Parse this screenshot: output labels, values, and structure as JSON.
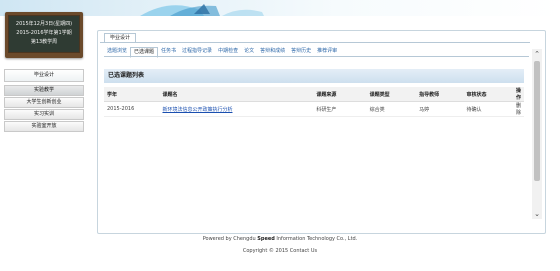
{
  "board": {
    "line1": "2015年12月3日(星期四)",
    "line2": "2015-2016学年第1学期",
    "line3": "第13教学周"
  },
  "sidebar": {
    "items": [
      {
        "label": "毕业设计"
      },
      {
        "label": "实验教学"
      },
      {
        "label": "大学生创新创业"
      },
      {
        "label": "实习实训"
      },
      {
        "label": "实验室开放"
      }
    ]
  },
  "main": {
    "outer_tab": "毕业设计",
    "subtabs": [
      "选题浏览",
      "已选课题",
      "任务书",
      "过程指导记录",
      "中期检查",
      "论文",
      "答辩和成绩",
      "答辩历史",
      "推荐评审"
    ],
    "section_title": "已选课题列表",
    "table": {
      "headers": [
        "学年",
        "课题名",
        "课题来源",
        "课题类型",
        "指导教师",
        "审核状态",
        "操作"
      ],
      "rows": [
        {
          "year": "2015-2016",
          "title": "新环境法信息公开政策执行分析",
          "source": "科研生产",
          "type": "综合类",
          "teacher": "马婷",
          "status": "待确认",
          "op": "删除"
        }
      ]
    }
  },
  "footer": {
    "line1_prefix": "Powered by Chengdu ",
    "line1_bold": "Speed",
    "line1_suffix": " Information Technology Co., Ltd.",
    "line2": "Copyright © 2015 Contact Us"
  }
}
